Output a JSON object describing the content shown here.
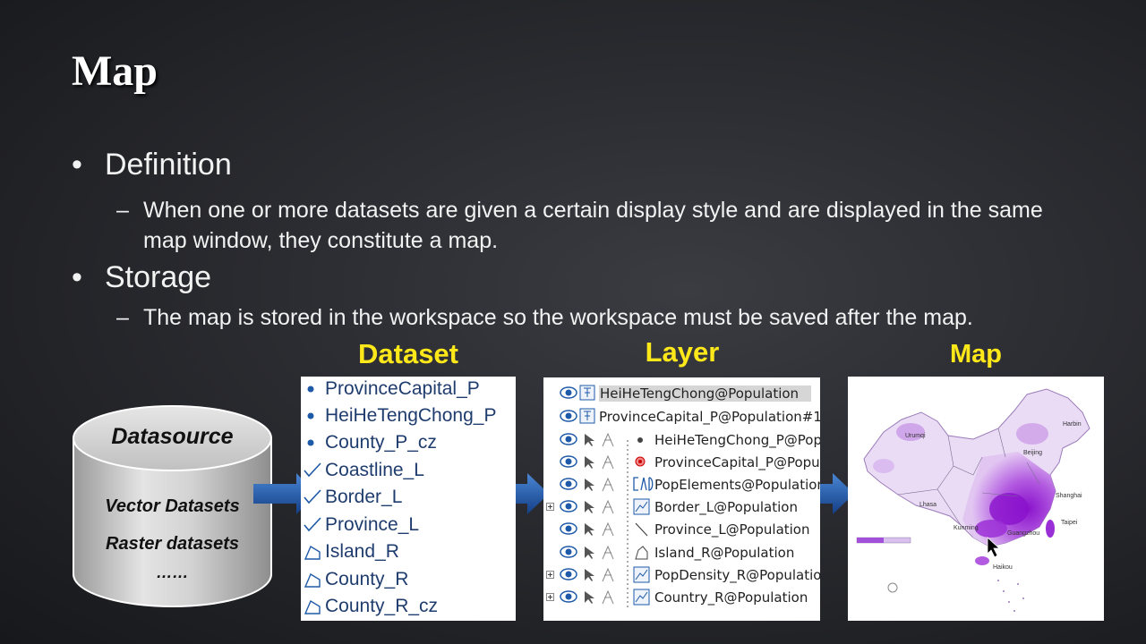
{
  "slide": {
    "title": "Map",
    "bullets": [
      {
        "label": "Definition",
        "sub": "When one or more datasets are given a certain display style and are displayed in the same map window, they constitute a map."
      },
      {
        "label": "Storage",
        "sub": "The map is stored in the workspace so the workspace must be saved after the map."
      }
    ],
    "bullet_glyph": "•",
    "dash_glyph": "–"
  },
  "diagram": {
    "headings": {
      "dataset": "Dataset",
      "layer": "Layer",
      "map": "Map"
    },
    "datasource": {
      "title": "Datasource",
      "lines": [
        "Vector Datasets",
        "Raster datasets",
        "……"
      ]
    },
    "datasets": [
      {
        "label": "ProvinceCapital_P",
        "icon": "point-icon"
      },
      {
        "label": "HeiHeTengChong_P",
        "icon": "point-icon"
      },
      {
        "label": "County_P_cz",
        "icon": "point-icon"
      },
      {
        "label": "Coastline_L",
        "icon": "line-icon"
      },
      {
        "label": "Border_L",
        "icon": "line-icon"
      },
      {
        "label": "Province_L",
        "icon": "line-icon"
      },
      {
        "label": "Island_R",
        "icon": "region-icon"
      },
      {
        "label": "County_R",
        "icon": "region-icon"
      },
      {
        "label": "County_R_cz",
        "icon": "region-icon"
      }
    ],
    "layers": [
      {
        "label": "HeiHeTengChong@Population",
        "selected": true
      },
      {
        "label": "ProvinceCapital_P@Population#1",
        "selected": false
      },
      {
        "label": "HeiHeTengChong_P@Population",
        "selected": false
      },
      {
        "label": "ProvinceCapital_P@Population",
        "selected": false
      },
      {
        "label": "PopElements@Population",
        "selected": false
      },
      {
        "label": "Border_L@Population",
        "selected": false
      },
      {
        "label": "Province_L@Population",
        "selected": false
      },
      {
        "label": "Island_R@Population",
        "selected": false
      },
      {
        "label": "PopDensity_R@Population",
        "selected": false
      },
      {
        "label": "Country_R@Population",
        "selected": false
      }
    ],
    "map_labels": [
      "Urumqi",
      "Lhasa",
      "Harbin",
      "Beijing",
      "Shanghai",
      "Taipei",
      "Kunming",
      "Guangzhou",
      "Haikou"
    ],
    "colors": {
      "heading": "#ffe81a",
      "arrow": "#1f5aa8",
      "density": "#9b2fd6"
    }
  }
}
